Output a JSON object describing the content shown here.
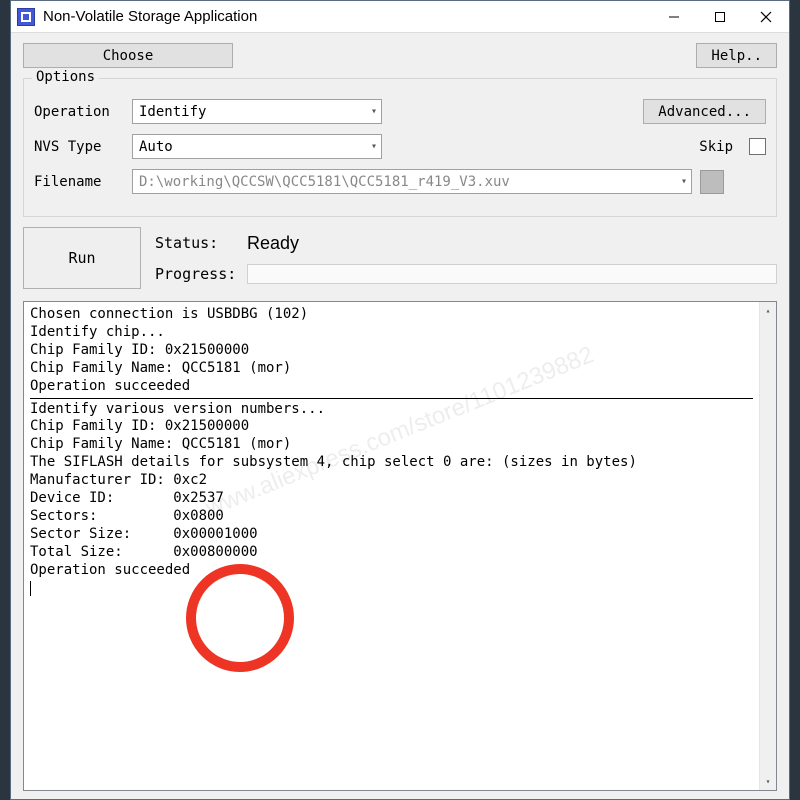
{
  "title": "Non-Volatile Storage Application",
  "buttons": {
    "choose": "Choose",
    "help": "Help..",
    "advanced": "Advanced...",
    "run": "Run"
  },
  "options": {
    "legend": "Options",
    "operation_label": "Operation",
    "operation_value": "Identify",
    "nvstype_label": "NVS Type",
    "nvstype_value": "Auto",
    "skip_label": "Skip",
    "filename_label": "Filename",
    "filename_value": "D:\\working\\QCCSW\\QCC5181\\QCC5181_r419_V3.xuv"
  },
  "status": {
    "status_label": "Status:",
    "status_value": "Ready",
    "progress_label": "Progress:"
  },
  "log": {
    "block1": "Chosen connection is USBDBG (102)\nIdentify chip...\nChip Family ID: 0x21500000\nChip Family Name: QCC5181 (mor)\nOperation succeeded",
    "block2": "Identify various version numbers...\nChip Family ID: 0x21500000\nChip Family Name: QCC5181 (mor)\nThe SIFLASH details for subsystem 4, chip select 0 are: (sizes in bytes)\nManufacturer ID: 0xc2\nDevice ID:       0x2537\nSectors:         0x0800\nSector Size:     0x00001000\nTotal Size:      0x00800000\nOperation succeeded"
  },
  "watermark": "www.aliexpress.com/store/1101239882"
}
